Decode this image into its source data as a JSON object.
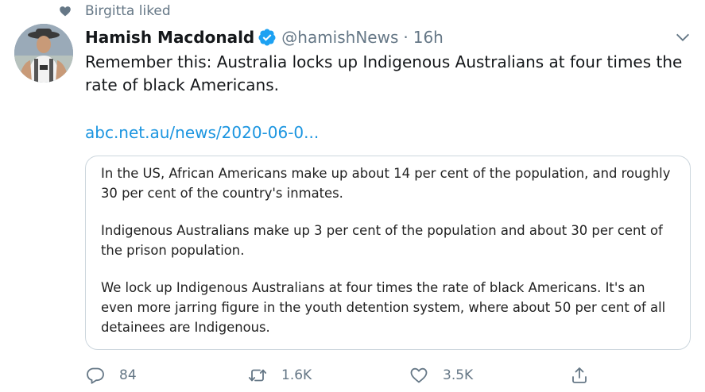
{
  "social_context": {
    "icon": "heart-icon",
    "text": "Birgitta liked"
  },
  "author": {
    "name": "Hamish Macdonald",
    "verified_icon": "verified-badge-icon",
    "handle": "@hamishNews",
    "separator": "·",
    "time": "16h"
  },
  "tweet": {
    "text": "Remember this: Australia locks up Indigenous Australians at four times the rate of black Americans.",
    "link": "abc.net.au/news/2020-06-0..."
  },
  "card": {
    "paragraphs": [
      "In the US, African Americans make up about 14 per cent of the population, and roughly 30 per cent of the country's inmates.",
      "Indigenous Australians make up 3 per cent of the population and about 30 per cent of the prison population.",
      "We lock up Indigenous Australians at four times the rate of black Americans. It's an even more jarring figure in the youth detention system, where about 50 per cent of all detainees are Indigenous."
    ]
  },
  "actions": {
    "reply": {
      "icon": "reply-icon",
      "count": "84"
    },
    "retweet": {
      "icon": "retweet-icon",
      "count": "1.6K"
    },
    "like": {
      "icon": "like-icon",
      "count": "3.5K"
    },
    "share": {
      "icon": "share-icon"
    }
  },
  "colors": {
    "accent": "#1b95e0",
    "muted": "#657786",
    "verified": "#1da1f2",
    "border": "#ccd6dd"
  }
}
